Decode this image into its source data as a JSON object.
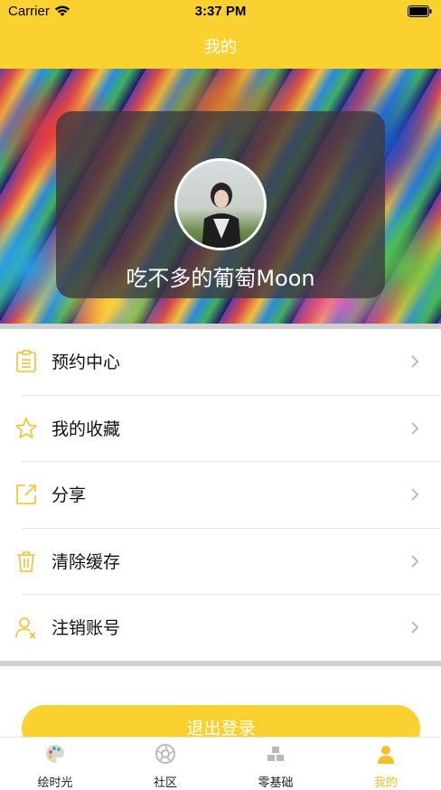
{
  "status_bar": {
    "carrier": "Carrier",
    "time": "3:37 PM"
  },
  "nav": {
    "title": "我的"
  },
  "profile": {
    "username": "吃不多的葡萄Moon"
  },
  "menu": [
    {
      "label": "预约中心",
      "icon": "clipboard-icon"
    },
    {
      "label": "我的收藏",
      "icon": "star-icon"
    },
    {
      "label": "分享",
      "icon": "share-icon"
    },
    {
      "label": "清除缓存",
      "icon": "trash-icon"
    },
    {
      "label": "注销账号",
      "icon": "user-remove-icon"
    }
  ],
  "logout_label": "退出登录",
  "tabs": [
    {
      "label": "绘时光",
      "icon": "palette-icon",
      "active": false
    },
    {
      "label": "社区",
      "icon": "aperture-icon",
      "active": false
    },
    {
      "label": "零基础",
      "icon": "blocks-icon",
      "active": false
    },
    {
      "label": "我的",
      "icon": "person-icon",
      "active": true
    }
  ],
  "colors": {
    "accent": "#fbd12f",
    "tab_active": "#f2c12a",
    "icon_inactive": "#b9b9b9"
  }
}
